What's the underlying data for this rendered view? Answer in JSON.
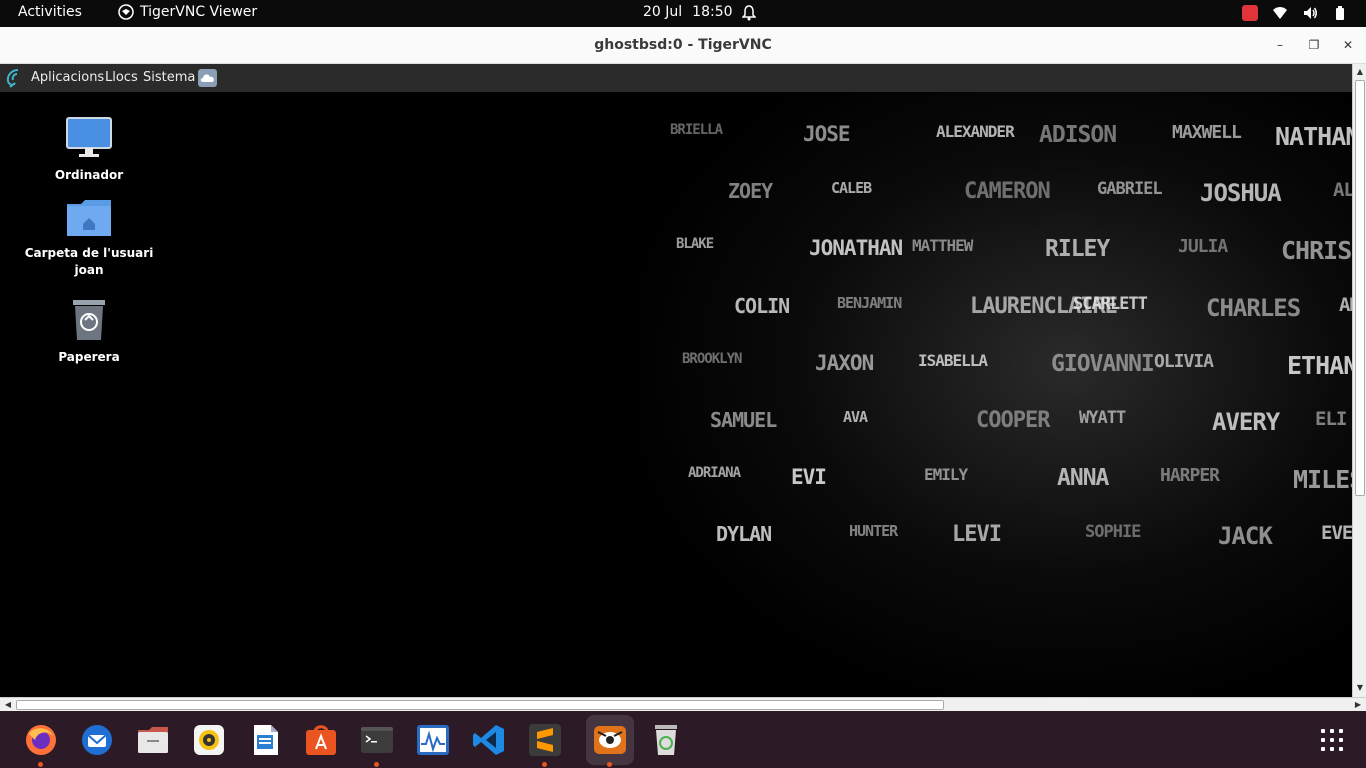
{
  "topbar": {
    "activities": "Activities",
    "app_name": "TigerVNC Viewer",
    "date": "20 Jul",
    "time": "18:50"
  },
  "window": {
    "title": "ghostbsd:0 - TigerVNC",
    "minimize": "–",
    "maximize": "❐",
    "close": "✕"
  },
  "remote_panel": {
    "menus": [
      "Aplicacions",
      "Llocs",
      "Sistema"
    ]
  },
  "desktop_icons": [
    {
      "label": "Ordinador",
      "icon": "monitor-icon"
    },
    {
      "label": "Carpeta de l'usuari joan",
      "icon": "home-folder-icon"
    },
    {
      "label": "Paperera",
      "icon": "trash-icon"
    }
  ],
  "wallpaper_words": [
    "BRIELLA",
    "JOSE",
    "ALEXANDER",
    "ADISON",
    "MAXWELL",
    "NATHAN",
    "ZOEY",
    "CALEB",
    "CAMERON",
    "GABRIEL",
    "JOSHUA",
    "ALEXIS",
    "BLAKE",
    "JONATHAN",
    "MATTHEW",
    "RILEY",
    "JULIA",
    "CHRISTIAN",
    "COLIN",
    "BENJAMIN",
    "LAURENCLAIRE",
    "SCARLETT",
    "CHARLES",
    "AMELIA",
    "BROOKLYN",
    "JAXON",
    "ISABELLA",
    "GIOVANNI",
    "OLIVIA",
    "ETHAN",
    "SAMUEL",
    "AVA",
    "COOPER",
    "WYATT",
    "AVERY",
    "ELI",
    "ADRIANA",
    "EVI",
    "EMILY",
    "ANNA",
    "HARPER",
    "MILES",
    "DYLAN",
    "HUNTER",
    "LEVI",
    "SOPHIE",
    "JACK",
    "EVELYN"
  ],
  "dock": {
    "items": [
      "firefox-icon",
      "thunderbird-icon",
      "files-icon",
      "rhythmbox-icon",
      "writer-icon",
      "app-center-icon",
      "terminal-icon",
      "system-monitor-icon",
      "vscode-icon",
      "sublime-icon",
      "tigervnc-icon",
      "trash-icon"
    ]
  },
  "colors": {
    "topbar": "#0b0b0b",
    "dock": "#2c1a27",
    "accent": "#e95420"
  }
}
